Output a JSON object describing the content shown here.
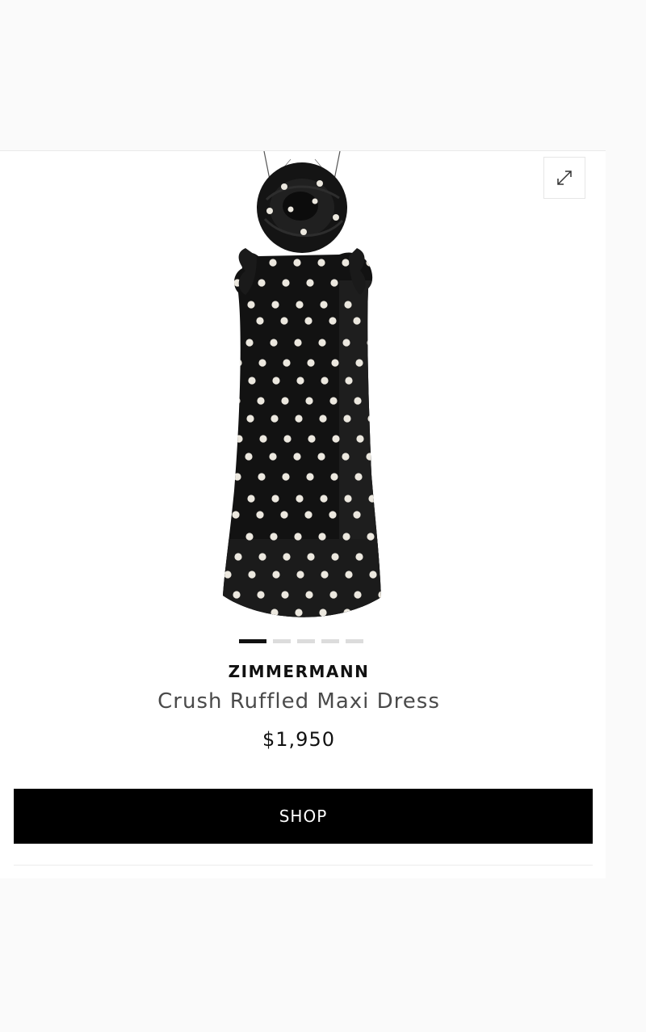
{
  "product": {
    "brand": "ZIMMERMANN",
    "title": "Crush Ruffled Maxi Dress",
    "price": "$1,950",
    "image_alt": "black polka dot ruffled maxi dress",
    "gallery": {
      "count": 5,
      "active_index": 0
    }
  },
  "actions": {
    "shop_label": "SHOP",
    "expand_icon": "expand-diagonal-arrows-icon"
  },
  "colors": {
    "button_bg": "#000000",
    "button_text": "#ffffff",
    "dress": "#111111",
    "dots": "#ece8df"
  }
}
